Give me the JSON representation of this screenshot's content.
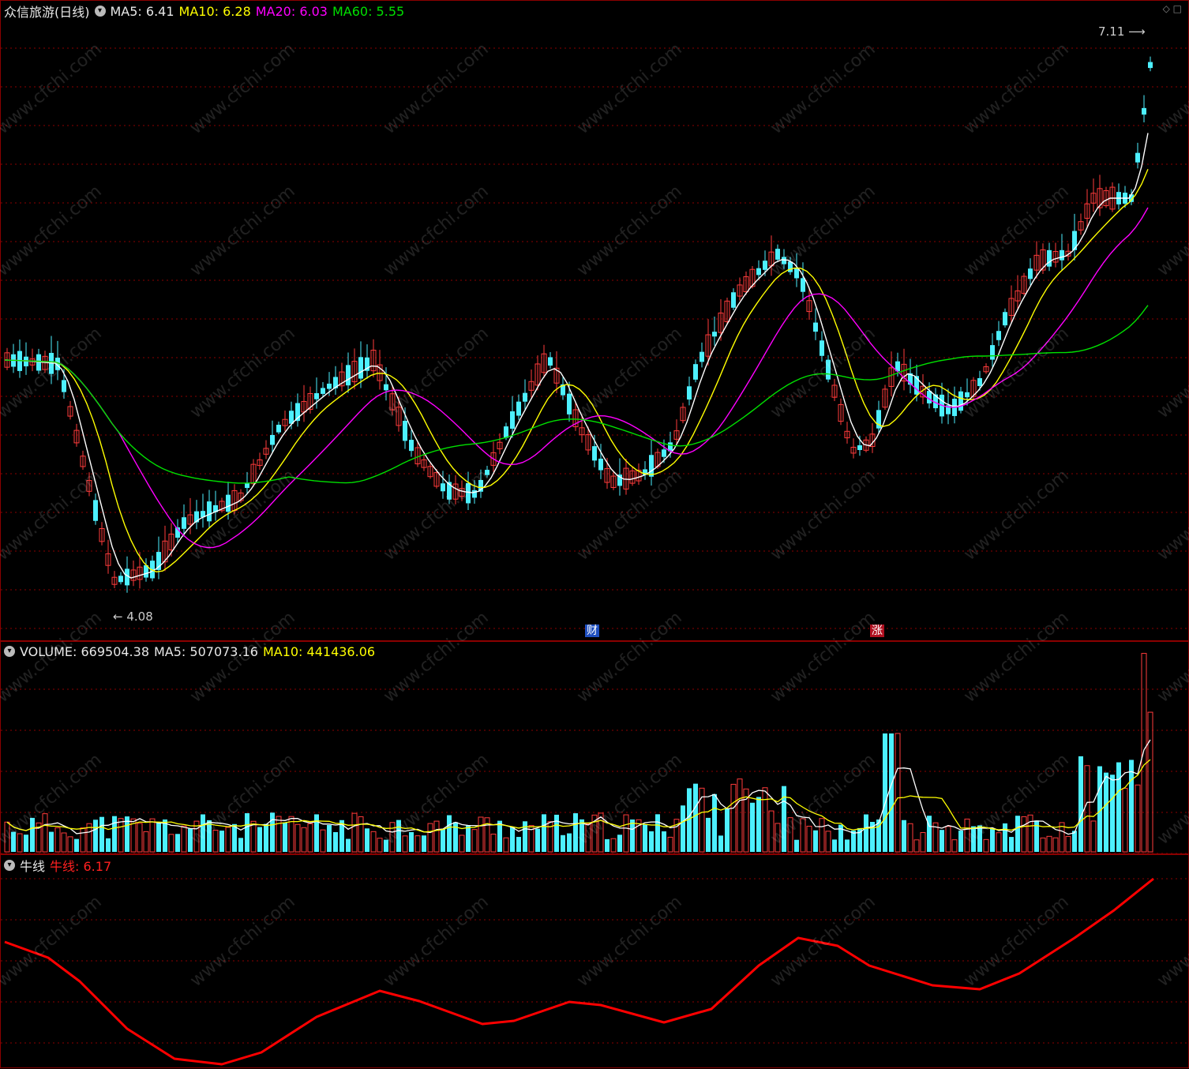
{
  "main": {
    "title": "众信旅游(日线)",
    "ma5_label": "MA5: 6.41",
    "ma10_label": "MA10: 6.28",
    "ma20_label": "MA20: 6.03",
    "ma60_label": "MA60: 5.55",
    "high_label": "7.11",
    "low_label": "4.08",
    "badge_cai": "财",
    "badge_zhang": "涨",
    "icons": [
      "diamond-icon",
      "square-icon"
    ]
  },
  "volume": {
    "volume_label": "VOLUME: 669504.38",
    "ma5_label": "MA5: 507073.16",
    "ma10_label": "MA10: 441436.06"
  },
  "niu": {
    "name": "牛线",
    "value_label": "牛线: 6.17"
  },
  "watermark": "www.cfchi.com",
  "colors": {
    "up": "#ff3b3b",
    "down": "#4df0ff",
    "ma5": "#ffffff",
    "ma10": "#ffff00",
    "ma20": "#ff00ff",
    "ma60": "#00e000",
    "niu": "#ff0000",
    "grid": "#8b0000"
  }
}
